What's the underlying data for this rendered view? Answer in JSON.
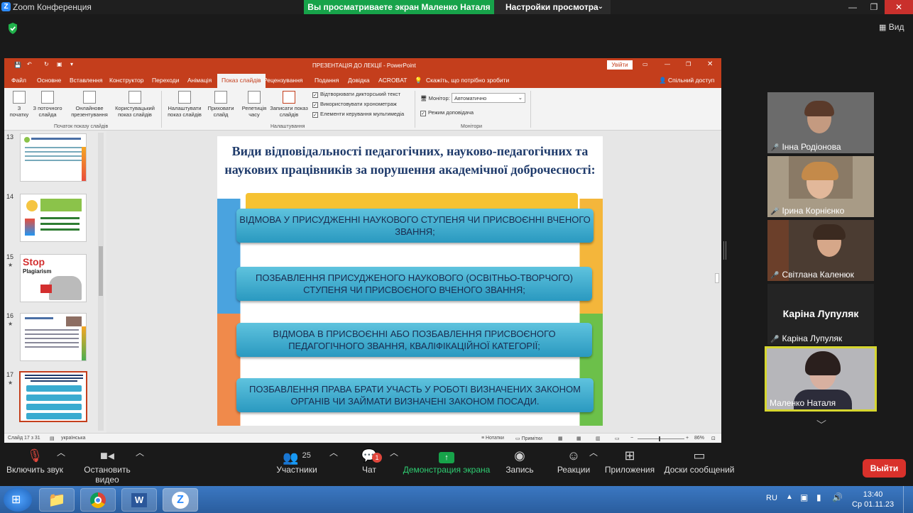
{
  "zoom": {
    "title": "Zoom Конференция",
    "share_banner": "Вы просматриваете экран Маленко Наталя",
    "view_settings": "Настройки просмотра",
    "view_label": "Вид"
  },
  "ppt": {
    "title": "ПРЕЗЕНТАЦІЯ ДО ЛЕКЦІЇ - PowerPoint",
    "signin": "Увійти",
    "tabs": [
      "Файл",
      "Основне",
      "Вставлення",
      "Конструктор",
      "Переходи",
      "Анімація",
      "Показ слайдів",
      "Рецензування",
      "Подання",
      "Довідка",
      "ACROBAT"
    ],
    "tell_me": "Скажіть, що потрібно зробити",
    "share": "Спільний доступ",
    "ribbon": {
      "from_start": "З\nпочатку",
      "from_current": "З поточного\nслайда",
      "online": "Онлайнове\nпрезентування",
      "custom": "Користувацький\nпоказ слайдів",
      "group_start": "Початок показу слайдів",
      "setup": "Налаштувати\nпоказ слайдів",
      "hide": "Приховати\nслайд",
      "rehearse": "Репетиція\nчасу",
      "record": "Записати показ\nслайдів",
      "chk_narration": "Відтворювати дикторський текст",
      "chk_timings": "Використовувати хронометраж",
      "chk_media": "Елементи керування мультимедіа",
      "group_setup": "Налаштування",
      "monitor_label": "Монітор:",
      "monitor_value": "Автоматично",
      "presenter_view": "Режим доповідача",
      "group_monitors": "Монітори"
    },
    "thumbs": [
      {
        "num": "13",
        "star": ""
      },
      {
        "num": "14",
        "star": ""
      },
      {
        "num": "15",
        "star": "★"
      },
      {
        "num": "16",
        "star": "★"
      },
      {
        "num": "17",
        "star": "★"
      }
    ],
    "thumb15_text": {
      "stop": "Stop",
      "plag": "Plagiarism"
    },
    "slide": {
      "title": "Види відповідальності педагогічних, науково-педагогічних та наукових працівників за порушення академічної доброчесності:",
      "items": [
        "ВІДМОВА У ПРИСУДЖЕННІ НАУКОВОГО СТУПЕНЯ ЧИ ПРИСВОЄННІ ВЧЕНОГО ЗВАННЯ;",
        "ПОЗБАВЛЕННЯ ПРИСУДЖЕНОГО НАУКОВОГО (ОСВІТНЬО-ТВОРЧОГО) СТУПЕНЯ ЧИ ПРИСВОЄНОГО ВЧЕНОГО ЗВАННЯ;",
        "ВІДМОВА В ПРИСВОЄННІ АБО ПОЗБАВЛЕННЯ ПРИСВОЄНОГО ПЕДАГОГІЧНОГО ЗВАННЯ, КВАЛІФІКАЦІЙНОЇ КАТЕГОРІЇ;",
        "ПОЗБАВЛЕННЯ ПРАВА БРАТИ УЧАСТЬ У РОБОТІ ВИЗНАЧЕНИХ ЗАКОНОМ ОРГАНІВ ЧИ ЗАЙМАТИ ВИЗНАЧЕНІ ЗАКОНОМ ПОСАДИ."
      ]
    },
    "status": {
      "slide_count": "Слайд 17 з 31",
      "language": "українська",
      "notes": "Нотатки",
      "comments": "Примітки",
      "zoom": "86%"
    }
  },
  "participants": [
    {
      "name": "Інна Родіонова",
      "muted": true
    },
    {
      "name": "Ірина Корнієнко",
      "muted": true
    },
    {
      "name": "Світлана Каленюк",
      "muted": true
    },
    {
      "name": "Каріна Лупуляк",
      "muted": true,
      "big_name": "Каріна Лупуляк"
    },
    {
      "name": "Маленко Наталя",
      "muted": false
    }
  ],
  "toolbar": {
    "unmute": "Включить звук",
    "stop_video": "Остановить видео",
    "participants": "Участники",
    "participants_count": "25",
    "chat": "Чат",
    "chat_badge": "1",
    "share_screen": "Демонстрация экрана",
    "record": "Запись",
    "reactions": "Реакции",
    "apps": "Приложения",
    "whiteboards": "Доски сообщений",
    "leave": "Выйти"
  },
  "taskbar": {
    "lang": "RU",
    "time": "13:40",
    "date": "Ср 01.11.23"
  },
  "colors": {
    "ppt_accent": "#c43e1c",
    "zoom_green": "#17a34a",
    "leave_red": "#d9312b",
    "speaking_border": "#d6d62e"
  }
}
